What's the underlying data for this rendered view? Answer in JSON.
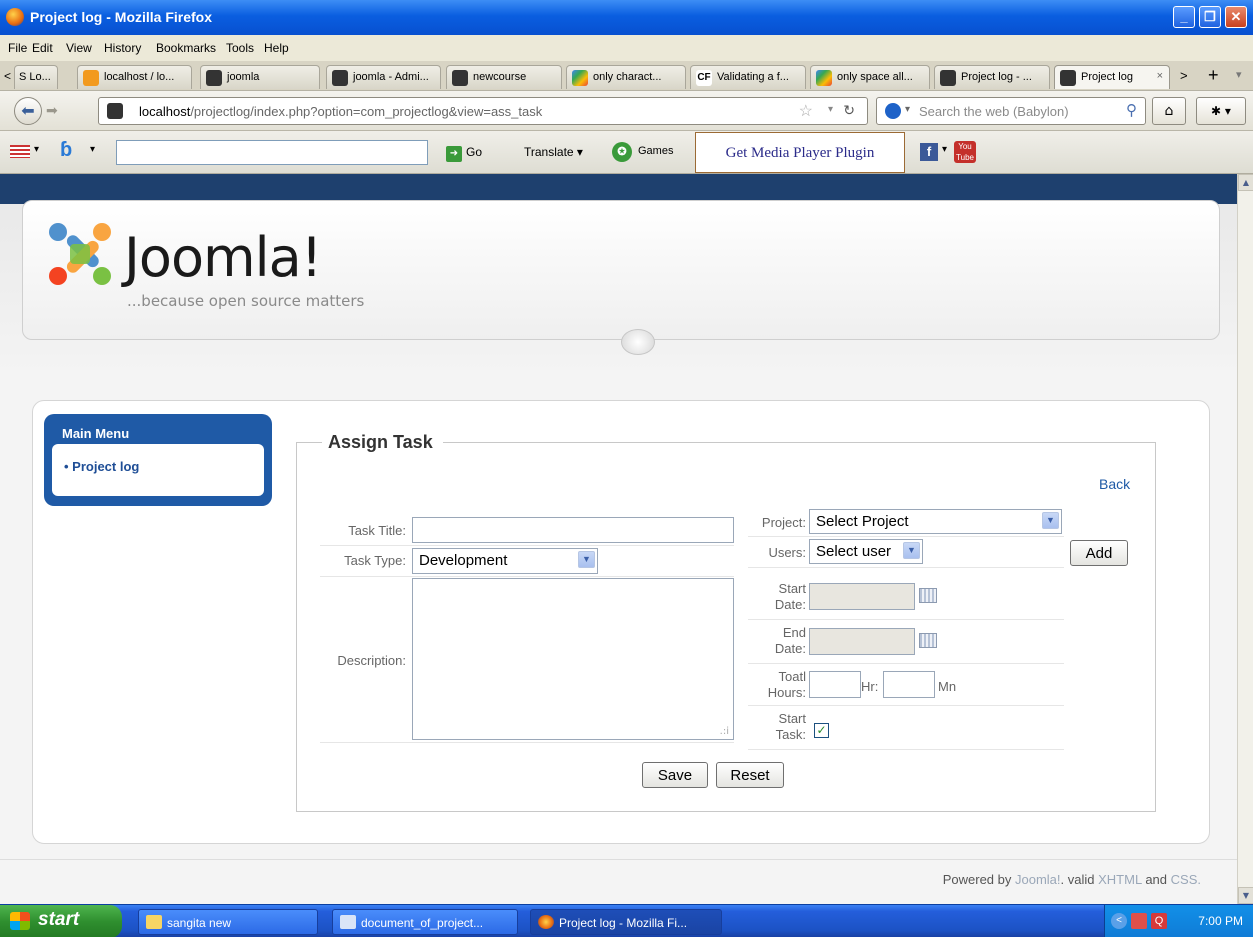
{
  "window": {
    "title": "Project log - Mozilla Firefox"
  },
  "menubar": [
    "File",
    "Edit",
    "View",
    "History",
    "Bookmarks",
    "Tools",
    "Help"
  ],
  "tabs": [
    {
      "label": "S Lo...",
      "color": "#ffffff"
    },
    {
      "label": "localhost / lo...",
      "color": "#f29a1e"
    },
    {
      "label": "joomla",
      "color": "#333333"
    },
    {
      "label": "joomla - Admi...",
      "color": "#333333"
    },
    {
      "label": "newcourse",
      "color": "#333333"
    },
    {
      "label": "only charact...",
      "color": "#4285f4"
    },
    {
      "label": "Validating a f...",
      "color": "#2a2a2a"
    },
    {
      "label": "only space all...",
      "color": "#4285f4"
    },
    {
      "label": "Project log - ...",
      "color": "#333333"
    },
    {
      "label": "Project log",
      "color": "#333333"
    }
  ],
  "tab_close": "×",
  "navbar": {
    "url_host": "localhost",
    "url_path": "/projectlog/index.php?option=com_projectlog&view=ass_task",
    "search_placeholder": "Search the web (Babylon)"
  },
  "toolbar2": {
    "go": "Go",
    "translate": "Translate",
    "games": "Games",
    "media_plugin": "Get Media Player Plugin"
  },
  "site": {
    "logo": "Joomla!",
    "tagline": "...because open source matters"
  },
  "menu": {
    "title": "Main Menu",
    "items": [
      "Project log"
    ]
  },
  "form": {
    "legend": "Assign Task",
    "back": "Back",
    "task_title_label": "Task Title:",
    "task_title_value": "",
    "task_type_label": "Task Type:",
    "task_type_value": "Development",
    "description_label": "Description:",
    "project_label": "Project:",
    "project_value": "Select Project",
    "users_label": "Users:",
    "users_value": "Select user",
    "add_button": "Add",
    "start_date_label_1": "Start",
    "start_date_label_2": "Date:",
    "end_date_label_1": "End",
    "end_date_label_2": "Date:",
    "total_hours_label_1": "Toatl",
    "total_hours_label_2": "Hours:",
    "hr_label": "Hr:",
    "mn_label": "Mn",
    "start_task_label_1": "Start",
    "start_task_label_2": "Task:",
    "start_task_checked": true,
    "save_button": "Save",
    "reset_button": "Reset"
  },
  "footer": {
    "powered_by": "Powered by",
    "joomla": "Joomla!",
    "valid": ". valid",
    "xhtml": "XHTML",
    "and": "and",
    "css": "CSS."
  },
  "taskbar": {
    "start": "start",
    "tasks": [
      {
        "label": "sangita new"
      },
      {
        "label": "document_of_project..."
      },
      {
        "label": "Project log - Mozilla Fi..."
      }
    ],
    "clock": "7:00 PM"
  }
}
